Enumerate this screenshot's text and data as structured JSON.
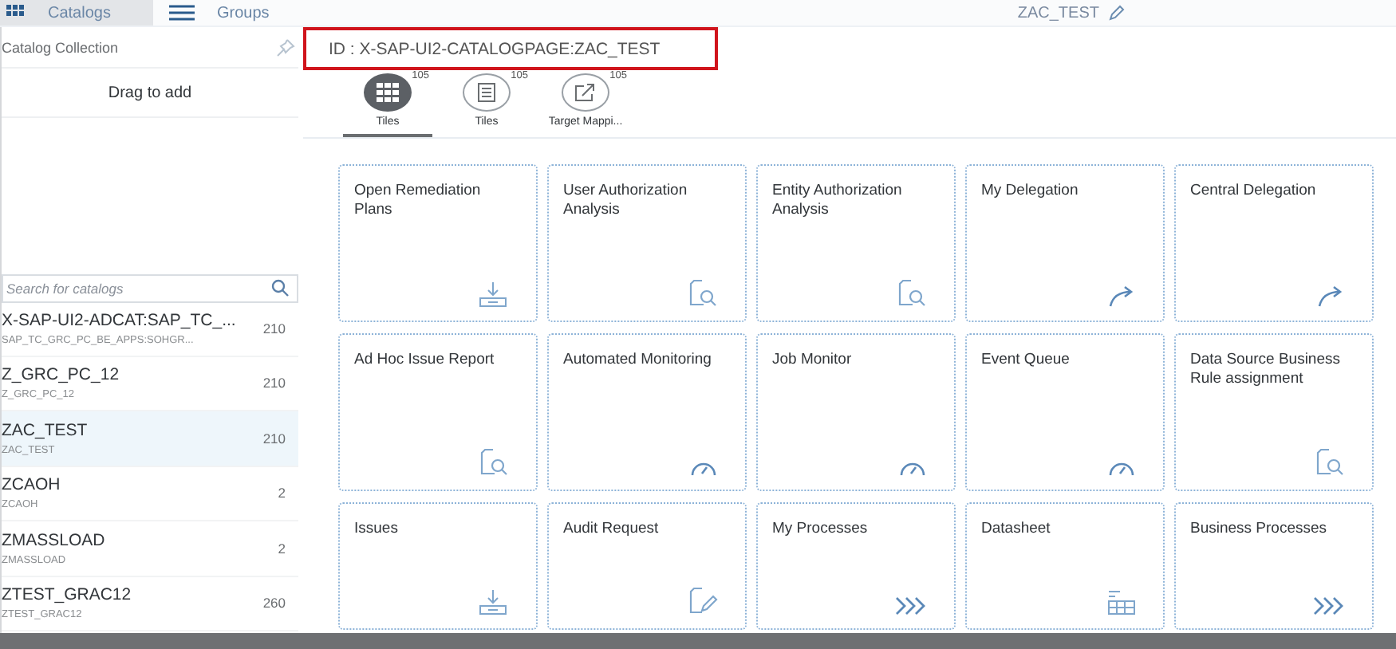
{
  "top_bar": {
    "tabs": [
      {
        "label": "Catalogs",
        "selected": true
      },
      {
        "label": "Groups",
        "selected": false
      }
    ],
    "title": "ZAC_TEST"
  },
  "sidebar": {
    "title": "Catalog Collection",
    "drop_zone": "Drag to add",
    "search": {
      "placeholder": "Search for catalogs"
    },
    "catalogs": [
      {
        "title": "X-SAP-UI2-ADCAT:SAP_TC_...",
        "subtitle": "SAP_TC_GRC_PC_BE_APPS:SOHGR...",
        "count": "210",
        "selected": false
      },
      {
        "title": "Z_GRC_PC_12",
        "subtitle": "Z_GRC_PC_12",
        "count": "210",
        "selected": false
      },
      {
        "title": "ZAC_TEST",
        "subtitle": "ZAC_TEST",
        "count": "210",
        "selected": true
      },
      {
        "title": "ZCAOH",
        "subtitle": "ZCAOH",
        "count": "2",
        "selected": false
      },
      {
        "title": "ZMASSLOAD",
        "subtitle": "ZMASSLOAD",
        "count": "2",
        "selected": false
      },
      {
        "title": "ZTEST_GRAC12",
        "subtitle": "ZTEST_GRAC12",
        "count": "260",
        "selected": false
      }
    ]
  },
  "header": {
    "id_label": "ID : X-SAP-UI2-CATALOGPAGE:ZAC_TEST"
  },
  "tabs": [
    {
      "kind": "grid",
      "count": "105",
      "label": "Tiles",
      "selected": true
    },
    {
      "kind": "list",
      "count": "105",
      "label": "Tiles",
      "selected": false
    },
    {
      "kind": "share",
      "count": "105",
      "label": "Target Mappi...",
      "selected": false
    }
  ],
  "tiles": [
    {
      "title": "Open Remediation Plans",
      "kind": "download"
    },
    {
      "title": "User Authorization Analysis",
      "kind": "doc-search"
    },
    {
      "title": "Entity Authorization Analysis",
      "kind": "doc-search"
    },
    {
      "title": "My Delegation",
      "kind": "forward"
    },
    {
      "title": "Central Delegation",
      "kind": "forward"
    },
    {
      "title": "Ad Hoc Issue Report",
      "kind": "doc-search"
    },
    {
      "title": "Automated Monitoring",
      "kind": "gauge"
    },
    {
      "title": "Job Monitor",
      "kind": "gauge"
    },
    {
      "title": "Event Queue",
      "kind": "gauge"
    },
    {
      "title": "Data Source Business Rule assignment",
      "kind": "doc-search"
    },
    {
      "title": "Issues",
      "kind": "download"
    },
    {
      "title": "Audit Request",
      "kind": "doc-edit"
    },
    {
      "title": "My Processes",
      "kind": "chevrons"
    },
    {
      "title": "Datasheet",
      "kind": "table"
    },
    {
      "title": "Business Processes",
      "kind": "chevrons"
    }
  ]
}
